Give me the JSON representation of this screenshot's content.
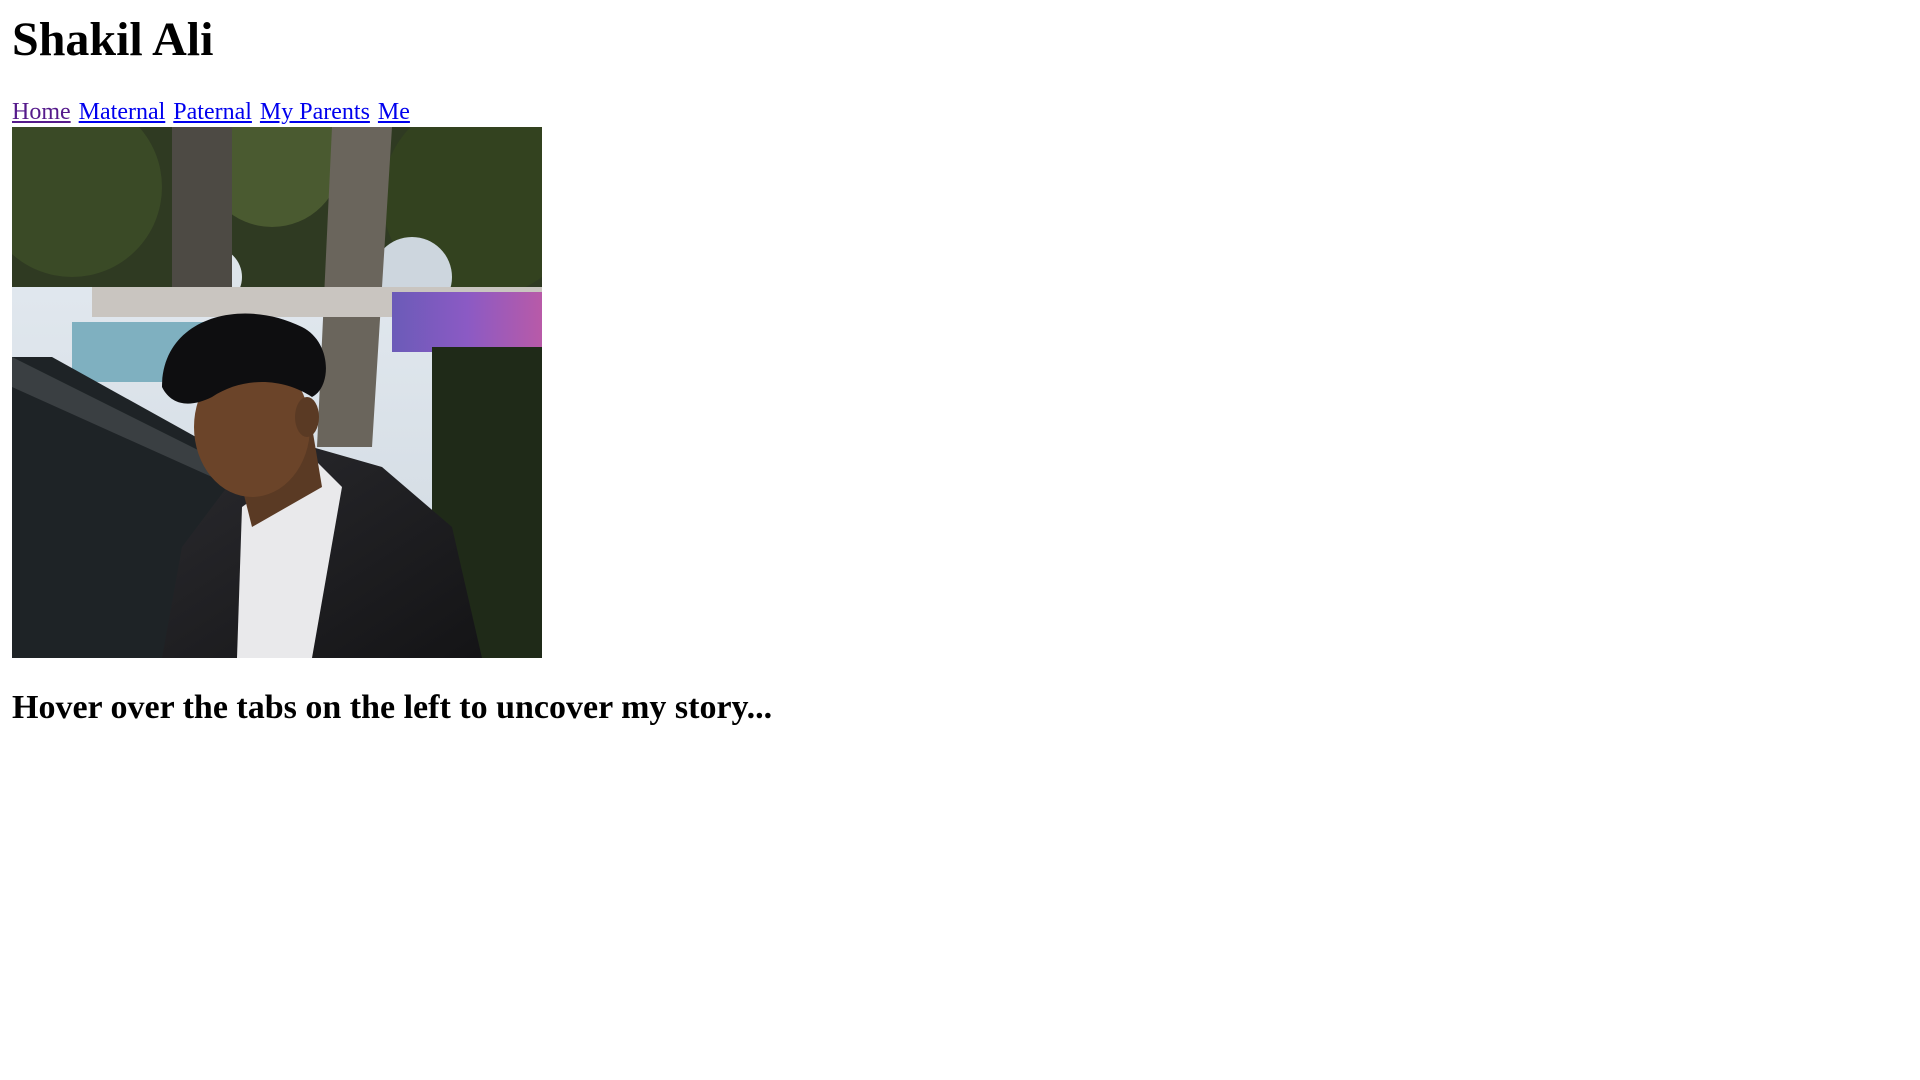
{
  "header": {
    "title": "Shakil Ali"
  },
  "nav": {
    "items": [
      {
        "label": "Home",
        "state": "visited"
      },
      {
        "label": "Maternal",
        "state": "unvisited"
      },
      {
        "label": "Paternal",
        "state": "unvisited"
      },
      {
        "label": "My Parents",
        "state": "unvisited"
      },
      {
        "label": "Me",
        "state": "unvisited"
      }
    ]
  },
  "main": {
    "tagline": "Hover over the tabs on the left to uncover my story..."
  },
  "colors": {
    "link": "#0000ee",
    "visited_link": "#551a8b",
    "text": "#000000",
    "background": "#ffffff"
  }
}
